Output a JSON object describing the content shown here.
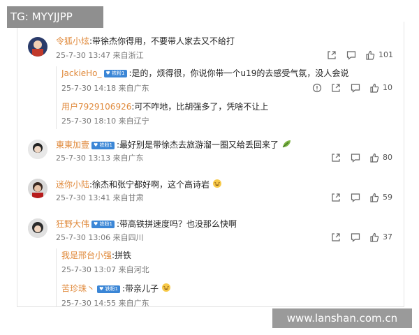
{
  "watermark_top": "TG: MYYJJPP",
  "watermark_bottom": "www.lanshan.com.cn",
  "badge_label": "铁粉1",
  "comments": [
    {
      "user": "令狐小炫",
      "text": ":带徐杰你得用，不要带人家去又不给打",
      "meta": "25-7-30 13:47 来自浙江",
      "likes": "101",
      "replies": [
        {
          "user": "JackieHo_",
          "badge": true,
          "text": ":是的，烦得很，你说你带一个u19的去感受气氛，没人会说",
          "meta": "25-7-30 14:18 来自广东",
          "likes": "10"
        },
        {
          "user": "用户7929106926",
          "text": ":可不咋地，比胡强多了，凭啥不让上",
          "meta": "25-7-30 18:10 来自辽宁"
        }
      ]
    },
    {
      "user": "東東加壹",
      "badge": true,
      "text": ":最好别是带徐杰去旅游溜一圈又给丢回来了",
      "meta": "25-7-30 13:13 来自广东",
      "likes": "80"
    },
    {
      "user": "迷你小陆",
      "text": ":徐杰和张宁都好啊，这个高诗岩",
      "meta": "25-7-30 13:41 来自甘肃",
      "likes": "59"
    },
    {
      "user": "狂野大伟",
      "badge": true,
      "text": ":带高铁拼速度吗？也没那么快啊",
      "meta": "25-7-30 13:06 来自四川",
      "likes": "37",
      "replies": [
        {
          "user": "我是邢台小强",
          "text": ":拼铁",
          "meta": "25-7-30 13:07 来自河北"
        },
        {
          "user": "苦珍珠丶",
          "badge": true,
          "text": ":带亲儿子",
          "meta": "25-7-30 14:55 来自广东"
        }
      ]
    }
  ]
}
